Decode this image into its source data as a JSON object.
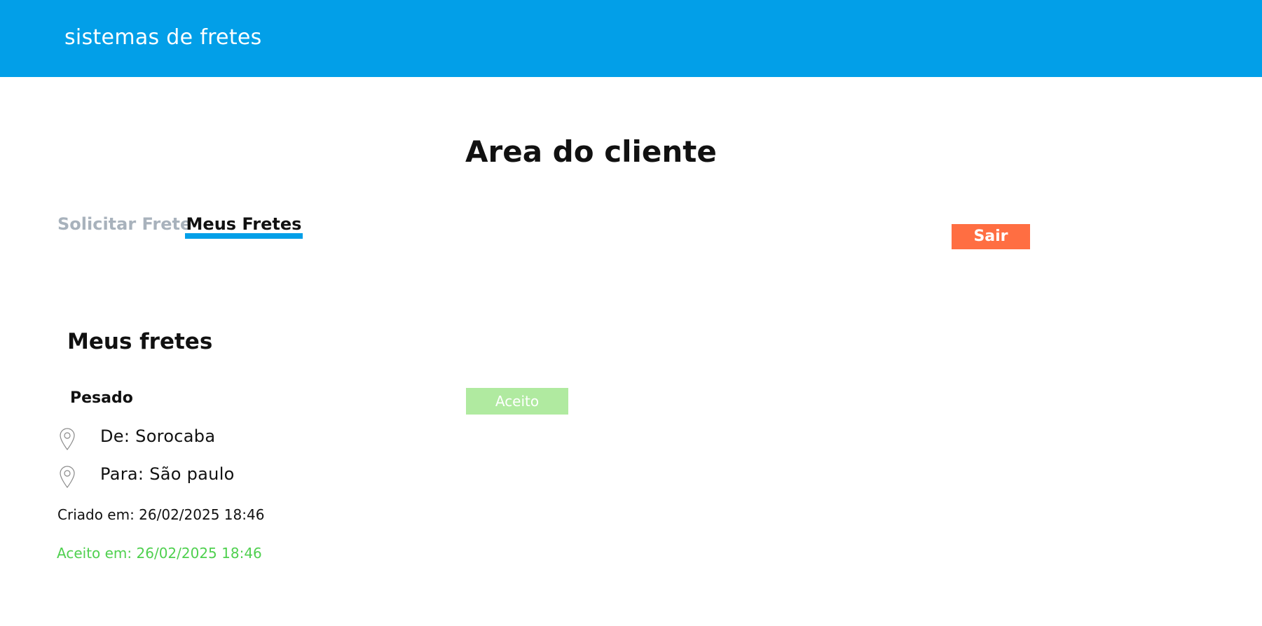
{
  "header": {
    "brand": "sistemas de fretes",
    "background_color": "#029fe8"
  },
  "page": {
    "title": "Area do cliente"
  },
  "tabs": [
    {
      "label": "Solicitar Frete",
      "active": false
    },
    {
      "label": "Meus Fretes",
      "active": true
    }
  ],
  "actions": {
    "logout_label": "Sair",
    "logout_color": "#ff6e42"
  },
  "freights_section": {
    "title": "Meus fretes",
    "items": [
      {
        "type": "Pesado",
        "status": "Aceito",
        "status_color": "#b0eaa0",
        "origin": "De: Sorocaba",
        "destination": "Para: São paulo",
        "created": "Criado em: 26/02/2025 18:46",
        "accepted": "Aceito em: 26/02/2025 18:46",
        "accepted_color": "#4fd04f",
        "icons": [
          "location-pin-icon",
          "location-pin-icon"
        ]
      }
    ]
  }
}
